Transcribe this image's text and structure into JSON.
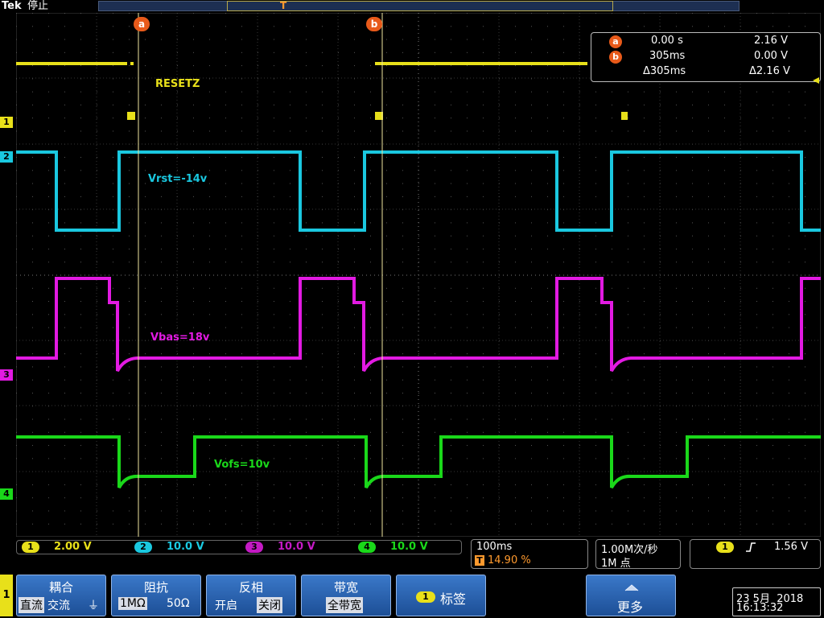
{
  "header": {
    "brand": "Tek",
    "run_state": "停止",
    "trigger_position_mark": "T"
  },
  "cursors": {
    "a_tag": "a",
    "b_tag": "b",
    "readout": {
      "a_time": "0.00 s",
      "a_volt": "2.16 V",
      "b_time": "305ms",
      "b_volt": "0.00 V",
      "delta_time": "Δ305ms",
      "delta_volt": "Δ2.16 V"
    }
  },
  "waveforms": [
    {
      "channel": "1",
      "label": "RESETZ",
      "color": "#e8e01a"
    },
    {
      "channel": "2",
      "label": "Vrst=-14v",
      "color": "#1ac8e0"
    },
    {
      "channel": "3",
      "label": "Vbas=18v",
      "color": "#e21ae2"
    },
    {
      "channel": "4",
      "label": "Vofs=10v",
      "color": "#1ad81a"
    }
  ],
  "channel_status": [
    {
      "num": "1",
      "scale": "2.00 V",
      "color": "#e8e01a"
    },
    {
      "num": "2",
      "scale": "10.0 V",
      "color": "#1ac8e0"
    },
    {
      "num": "3",
      "scale": "10.0 V",
      "color": "#e21ae2"
    },
    {
      "num": "4",
      "scale": "10.0 V",
      "color": "#1ad81a"
    }
  ],
  "timebase": {
    "scale": "100ms",
    "trigger_icon": "T",
    "position": "14.90 %",
    "sample_rate": "1.00M次/秒",
    "record_length": "1M 点"
  },
  "trigger": {
    "source": "1",
    "slope_icon": "rising-edge",
    "level": "1.56 V"
  },
  "menu": {
    "side_channel": "1",
    "coupling": {
      "title": "耦合",
      "opt1": "直流",
      "opt2": "交流",
      "opt3": "⏚"
    },
    "impedance": {
      "title": "阻抗",
      "opt1": "1MΩ",
      "opt2": "50Ω"
    },
    "invert": {
      "title": "反相",
      "opt1": "开启",
      "opt2": "关闭"
    },
    "bandwidth": {
      "title": "带宽",
      "opt1": "全带宽"
    },
    "label": {
      "num": "1",
      "title": "标签"
    },
    "more": {
      "title": "更多"
    }
  },
  "datetime": {
    "date": "23 5月  2018",
    "time": "16:13:32"
  }
}
